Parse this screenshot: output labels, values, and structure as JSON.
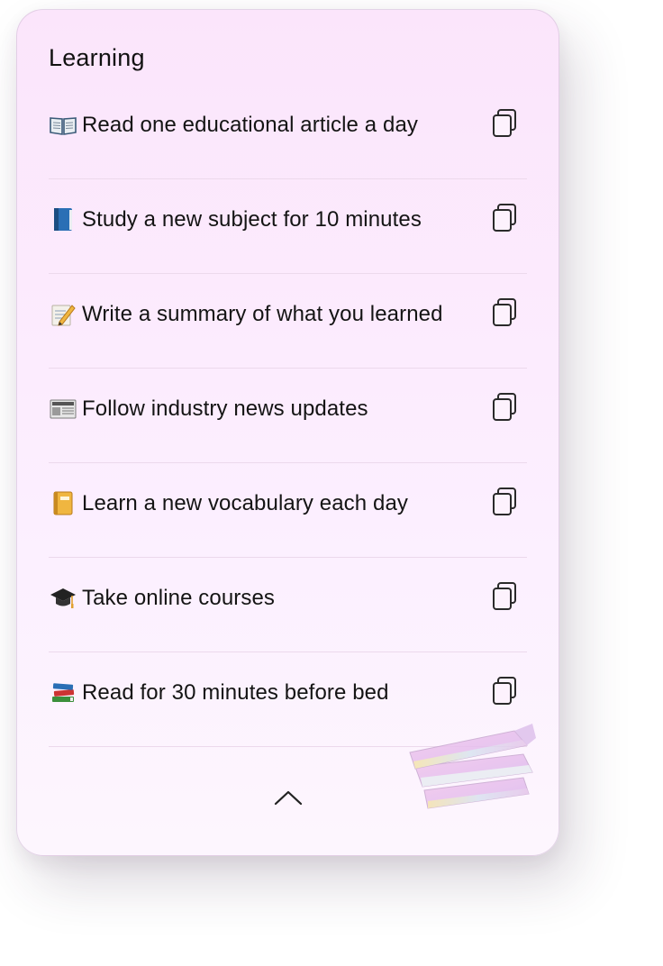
{
  "card": {
    "title": "Learning",
    "items": [
      {
        "emoji": "open-book-icon",
        "text": "Read one educational article a day"
      },
      {
        "emoji": "blue-book-icon",
        "text": "Study a new subject for 10 minutes"
      },
      {
        "emoji": "memo-icon",
        "text": "Write a summary of what you learned"
      },
      {
        "emoji": "newspaper-icon",
        "text": "Follow industry news updates"
      },
      {
        "emoji": "notebook-icon",
        "text": "Learn a new vocabulary each day"
      },
      {
        "emoji": "graduation-cap-icon",
        "text": "Take online courses"
      },
      {
        "emoji": "books-stack-icon",
        "text": "Read for 30 minutes before bed"
      }
    ]
  },
  "colors": {
    "card_bg_top": "#fbe5fb",
    "card_bg_bottom": "#fdf6fe",
    "divider": "#ecd9ec",
    "text": "#141414"
  }
}
